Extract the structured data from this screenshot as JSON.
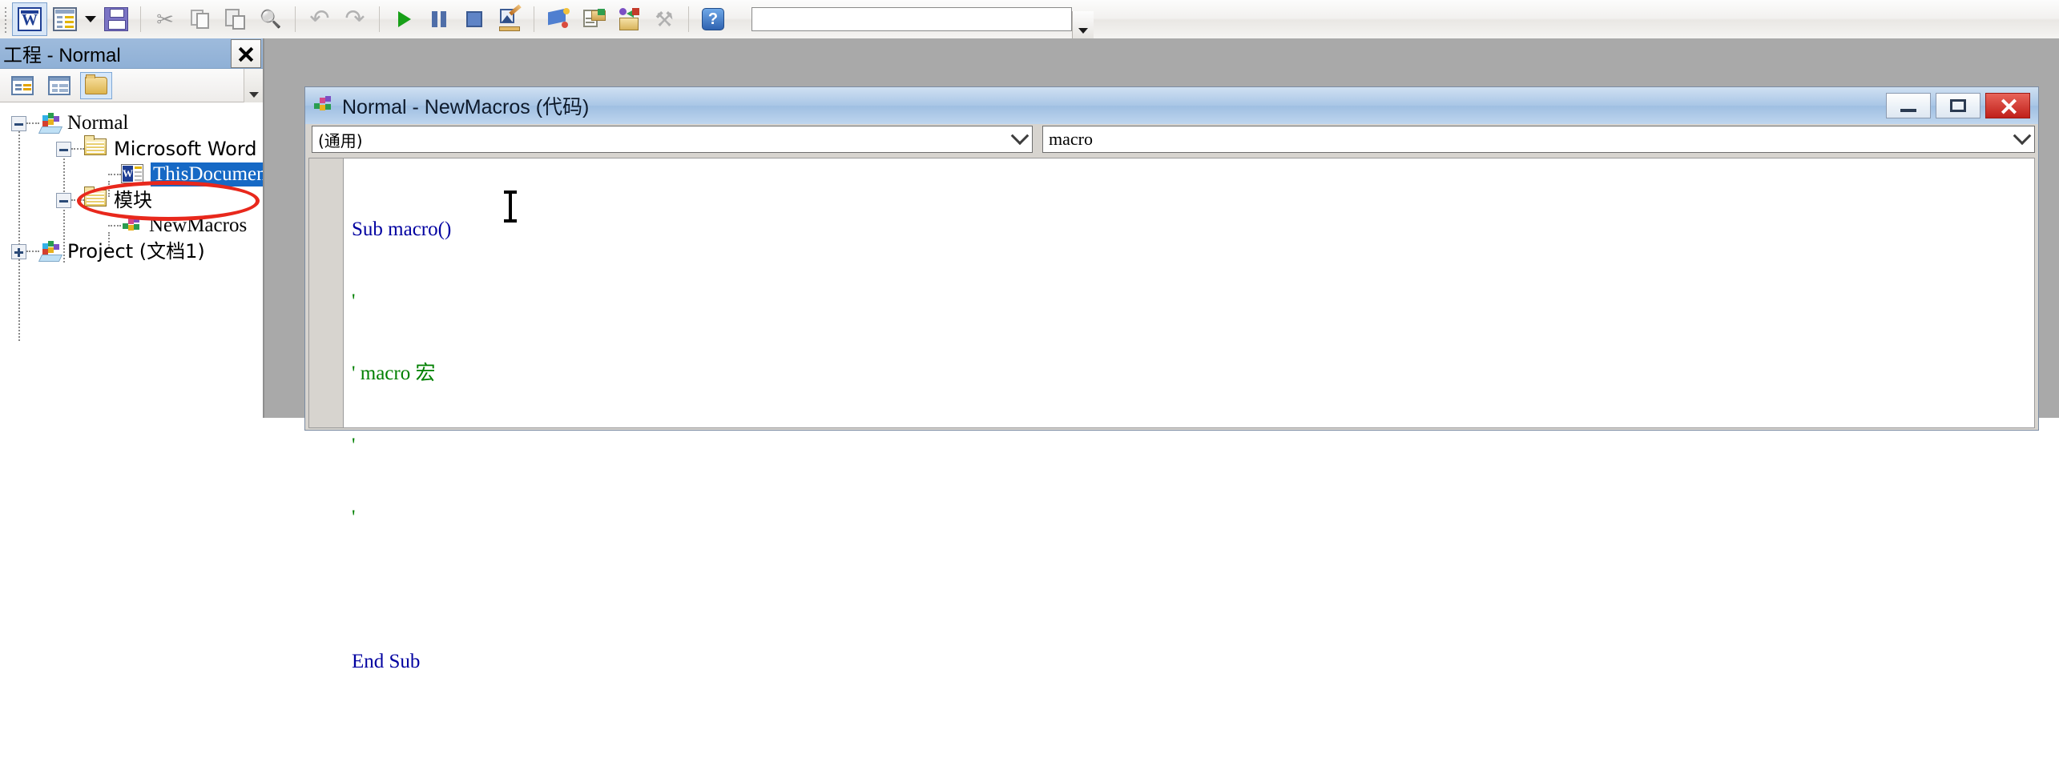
{
  "toolbar": {
    "buttons": [
      {
        "name": "view-word-button",
        "icon": "word-icon",
        "label": "视图 Microsoft Word"
      },
      {
        "name": "insert-userform-button",
        "icon": "insert-object-icon",
        "label": "插入"
      },
      {
        "name": "insert-dropdown-button",
        "icon": "chevron-down-icon",
        "label": "插入下拉"
      },
      {
        "name": "save-button",
        "icon": "save-floppy-icon",
        "label": "保存 Normal"
      },
      {
        "name": "cut-button",
        "icon": "scissors-icon",
        "label": "剪切"
      },
      {
        "name": "copy-button",
        "icon": "copy-icon",
        "label": "复制"
      },
      {
        "name": "paste-button",
        "icon": "paste-icon",
        "label": "粘贴"
      },
      {
        "name": "find-button",
        "icon": "binoculars-icon",
        "label": "查找"
      },
      {
        "name": "undo-button",
        "icon": "undo-arrow-icon",
        "label": "撤消"
      },
      {
        "name": "redo-button",
        "icon": "redo-arrow-icon",
        "label": "恢复"
      },
      {
        "name": "run-button",
        "icon": "play-triangle-icon",
        "label": "运行子过程/用户窗体"
      },
      {
        "name": "break-button",
        "icon": "pause-bars-icon",
        "label": "中断"
      },
      {
        "name": "reset-button",
        "icon": "stop-square-icon",
        "label": "重新设置"
      },
      {
        "name": "design-mode-button",
        "icon": "design-ruler-pencil-icon",
        "label": "设计模式"
      },
      {
        "name": "project-explorer-button",
        "icon": "project-explorer-icon",
        "label": "工程资源管理器"
      },
      {
        "name": "properties-window-button",
        "icon": "properties-window-icon",
        "label": "属性窗口"
      },
      {
        "name": "object-browser-button",
        "icon": "object-browser-icon",
        "label": "对象浏览器"
      },
      {
        "name": "toolbox-button",
        "icon": "hammer-wrench-icon",
        "label": "工具箱"
      },
      {
        "name": "help-button",
        "icon": "help-question-icon",
        "label": "帮助"
      }
    ],
    "combo": {
      "value": "",
      "placeholder": ""
    }
  },
  "project_explorer": {
    "title": "工程 - Normal",
    "close_label": "✕",
    "toolbar_buttons": [
      {
        "name": "view-code-button",
        "icon": "view-code-icon",
        "label": "查看代码"
      },
      {
        "name": "view-object-button",
        "icon": "view-object-icon",
        "label": "查看对象"
      },
      {
        "name": "toggle-folders-button",
        "icon": "folder-icon",
        "label": "切换文件夹",
        "active": true
      }
    ],
    "tree": [
      {
        "name": "tree-node-normal",
        "label": "Normal",
        "icon": "vba-project-icon",
        "depth": 0,
        "expander": "minus",
        "cjk": false,
        "selected": false
      },
      {
        "name": "tree-node-word-objects",
        "label": "Microsoft Word 对象",
        "icon": "folder-icon",
        "depth": 1,
        "expander": "minus",
        "cjk": true,
        "selected": false
      },
      {
        "name": "tree-node-thisdocument",
        "label": "ThisDocument",
        "icon": "word-document-icon",
        "depth": 2,
        "expander": "none",
        "cjk": false,
        "selected": true
      },
      {
        "name": "tree-node-modules",
        "label": "模块",
        "icon": "folder-icon",
        "depth": 1,
        "expander": "minus",
        "cjk": true,
        "selected": false
      },
      {
        "name": "tree-node-newmacros",
        "label": "NewMacros",
        "icon": "module-icon",
        "depth": 2,
        "expander": "none",
        "cjk": false,
        "selected": false
      },
      {
        "name": "tree-node-project",
        "label": "Project (文档1)",
        "icon": "vba-project-icon",
        "depth": 0,
        "expander": "plus",
        "cjk": true,
        "selected": false
      }
    ]
  },
  "annotation": {
    "shape": "ellipse",
    "color": "#e8281c",
    "target": "tree-node-thisdocument"
  },
  "code_window": {
    "title": "Normal - NewMacros (代码)",
    "window_buttons": [
      {
        "name": "minimize-button",
        "label": "最小化"
      },
      {
        "name": "maximize-button",
        "label": "最大化"
      },
      {
        "name": "close-button",
        "label": "关闭"
      }
    ],
    "object_combo": {
      "name": "object-combo",
      "value": "(通用)"
    },
    "procedure_combo": {
      "name": "procedure-combo",
      "value": "macro"
    },
    "code_lines": [
      {
        "text": "Sub macro()",
        "type": "code"
      },
      {
        "text": "'",
        "type": "comment"
      },
      {
        "text": "' macro 宏",
        "type": "comment"
      },
      {
        "text": "'",
        "type": "comment"
      },
      {
        "text": "'",
        "type": "comment"
      },
      {
        "text": "",
        "type": "code"
      },
      {
        "text": "End Sub",
        "type": "code"
      }
    ],
    "colors": {
      "code": "#000080",
      "comment": "#008000",
      "background": "#ffffff",
      "title_bar": "#a9c6e6"
    }
  }
}
